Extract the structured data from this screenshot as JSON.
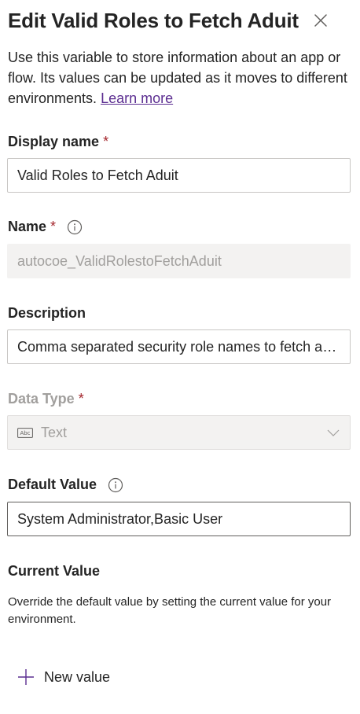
{
  "panel": {
    "title": "Edit Valid Roles to Fetch Aduit",
    "intro": "Use this variable to store information about an app or flow. Its values can be updated as it moves to different environments.",
    "learn_more": "Learn more"
  },
  "display_name": {
    "label": "Display name",
    "required_mark": "*",
    "value": "Valid Roles to Fetch Aduit"
  },
  "name": {
    "label": "Name",
    "required_mark": "*",
    "value": "autocoe_ValidRolestoFetchAduit"
  },
  "description": {
    "label": "Description",
    "value": "Comma separated security role names to fetch audit"
  },
  "data_type": {
    "label": "Data Type",
    "required_mark": "*",
    "icon_text": "Abc",
    "value": "Text"
  },
  "default_value": {
    "label": "Default Value",
    "value": "System Administrator,Basic User"
  },
  "current_value": {
    "label": "Current Value",
    "help": "Override the default value by setting the current value for your environment.",
    "new_value_label": "New value"
  },
  "colors": {
    "link": "#5c2e91",
    "required": "#a4262c",
    "disabled_text": "#a19f9d",
    "readonly_bg": "#f3f2f1"
  }
}
